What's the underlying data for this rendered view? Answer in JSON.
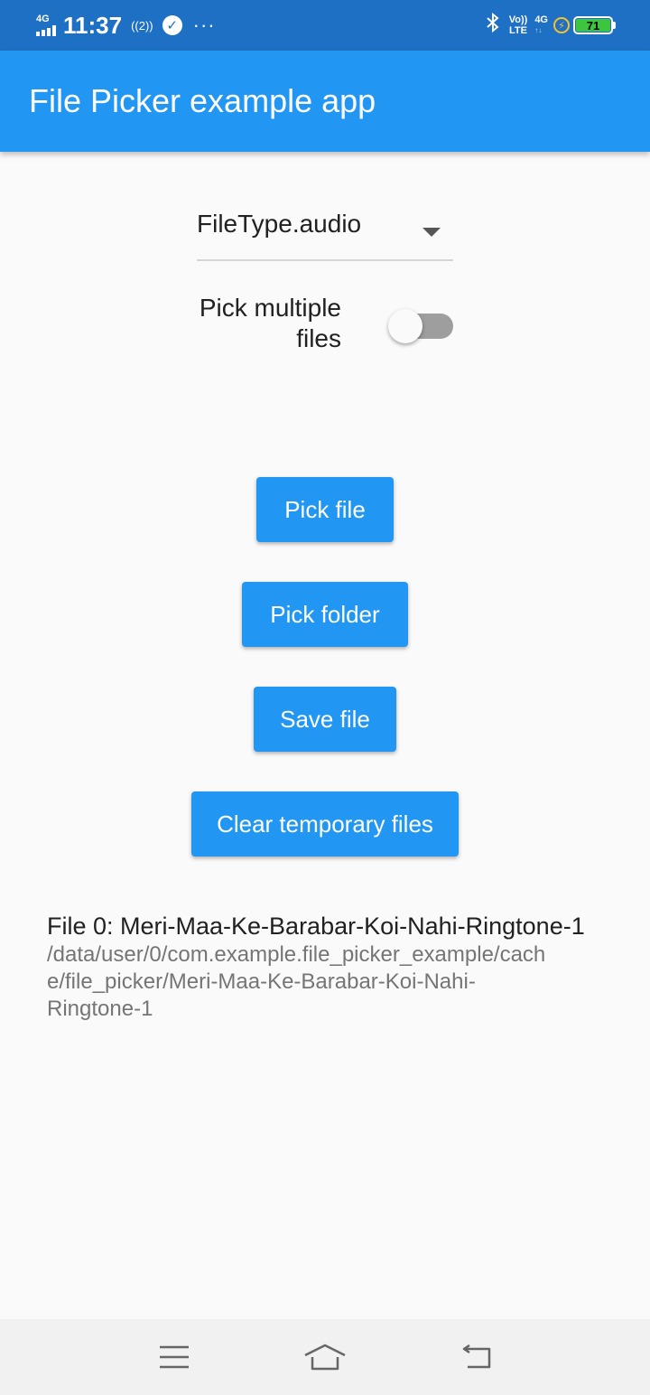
{
  "status_bar": {
    "network_type": "4G",
    "time": "11:37",
    "hotspot_label": "((2))",
    "volte_top": "Vo))",
    "volte_bottom": "LTE",
    "net_right": "4G",
    "net_right_sub": "↑↓",
    "battery_level": "71",
    "icons": [
      "signal-icon",
      "hotspot-icon",
      "check-icon",
      "more-icon",
      "bluetooth-icon",
      "volte-icon",
      "charging-icon",
      "battery-icon"
    ]
  },
  "app_bar": {
    "title": "File Picker example app"
  },
  "dropdown": {
    "value": "FileType.audio"
  },
  "multi_pick": {
    "label": "Pick multiple files",
    "enabled": false
  },
  "buttons": {
    "pick_file": "Pick file",
    "pick_folder": "Pick folder",
    "save_file": "Save file",
    "clear_temp": "Clear temporary files"
  },
  "files": [
    {
      "title": "File 0: Meri-Maa-Ke-Barabar-Koi-Nahi-Ringtone-1",
      "path": "/data/user/0/com.example.file_picker_example/cache/file_picker/Meri-Maa-Ke-Barabar-Koi-Nahi-Ringtone-1"
    }
  ],
  "colors": {
    "status_bar": "#1e70c4",
    "primary": "#2196f3",
    "background": "#fafafa",
    "switch_track_off": "#9e9e9e"
  },
  "nav_bar": {
    "icons": [
      "menu-icon",
      "home-icon",
      "back-icon"
    ]
  }
}
